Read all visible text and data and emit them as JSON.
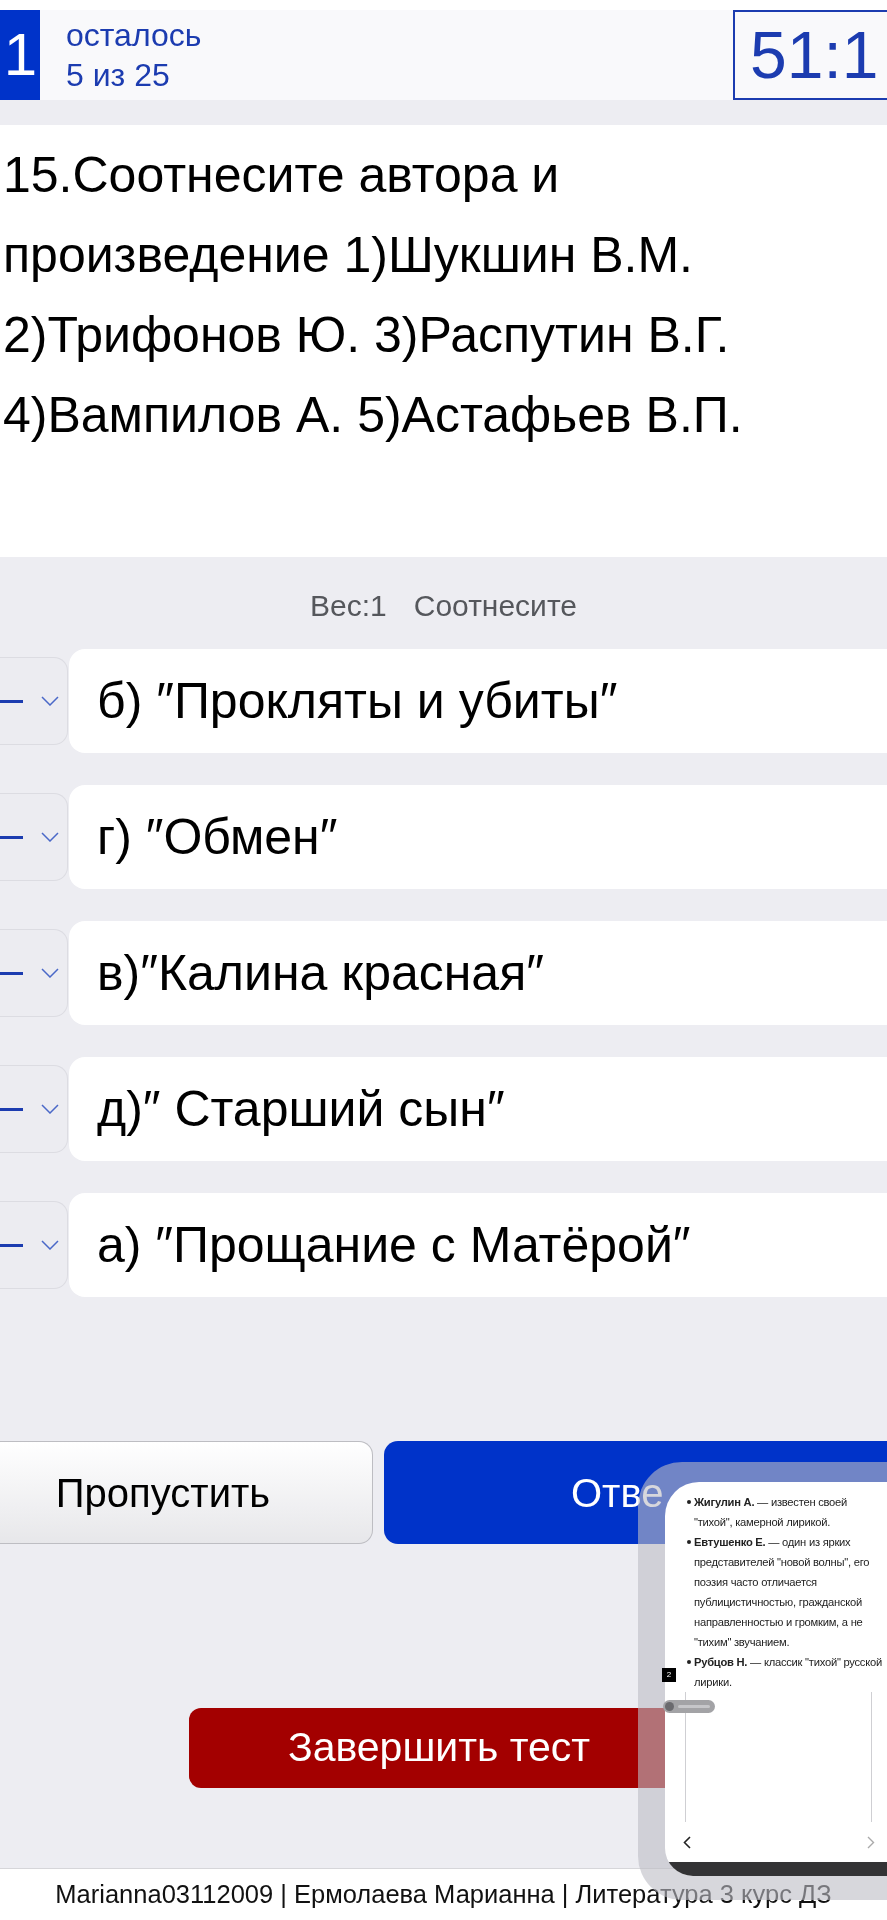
{
  "header": {
    "question_number": "1",
    "remaining_label": "осталось",
    "remaining_count": "5 из 25",
    "timer": "51:1"
  },
  "question": {
    "text": "15.Соотнесите автора и произведение 1)Шукшин В.М. 2)Трифонов Ю. 3)Распутин В.Г. 4)Вампилов А. 5)Астафьев В.П."
  },
  "task_info": {
    "weight": "Вес:1",
    "type": "Соотнесите"
  },
  "matches": [
    {
      "text": "б) ″Прокляты и убиты″"
    },
    {
      "text": "г) ″Обмен″"
    },
    {
      "text": "в)″Калина красная″"
    },
    {
      "text": "д)″ Старший сын″"
    },
    {
      "text": "а) ″Прощание с Матёрой″"
    }
  ],
  "buttons": [
    {
      "kind": "skip",
      "label": "Пропустить"
    },
    {
      "kind": "answer",
      "label": "Отве"
    },
    {
      "kind": "finish",
      "label": "Завершить тест"
    }
  ],
  "floating_window": {
    "items": [
      {
        "text": "**Жигулин А.** — известен своей \"тихой\", камерной лирикой."
      },
      {
        "text": "**Евтушенко Е.** — один из ярких представителей \"новой волны\", его поэзия часто отличается публицистичностью, гражданской направленностью и громким, а не \"тихим\" звучанием."
      },
      {
        "text": "**Рубцов Н.** — классик \"тихой\" русской лирики."
      }
    ],
    "page_number": "2"
  },
  "footer": {
    "text": "Marianna03112009 | Ермолаева Марианна | Литература 3 курс ДЗ"
  }
}
